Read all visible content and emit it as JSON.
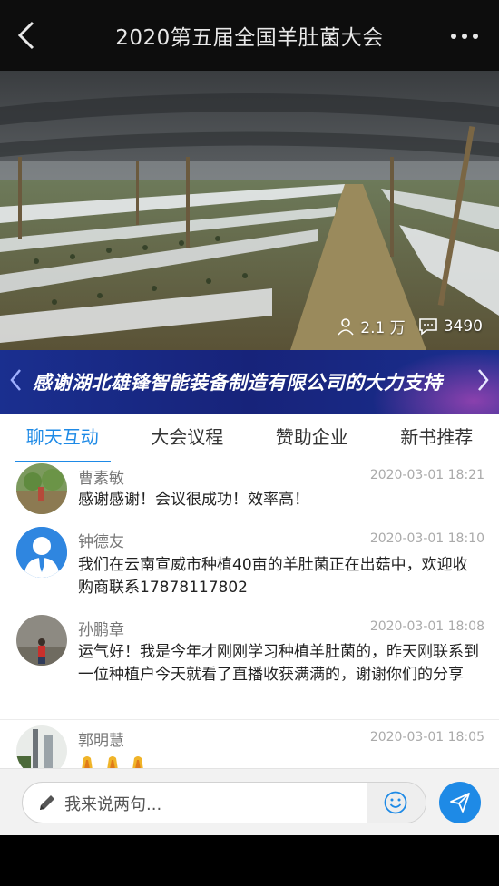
{
  "header": {
    "title": "2020第五届全国羊肚菌大会"
  },
  "video": {
    "viewers": "2.1 万",
    "comments": "3490"
  },
  "banner": {
    "text": "感谢湖北雄锋智能装备制造有限公司的大力支持"
  },
  "tabs": [
    {
      "label": "聊天互动",
      "active": true
    },
    {
      "label": "大会议程",
      "active": false
    },
    {
      "label": "赞助企业",
      "active": false
    },
    {
      "label": "新书推荐",
      "active": false
    }
  ],
  "messages": [
    {
      "name": "曹素敏",
      "time": "2020-03-01 18:21",
      "text": "感谢感谢！会议很成功！效率高！"
    },
    {
      "name": "钟德友",
      "time": "2020-03-01 18:10",
      "text": "我们在云南宣威市种植40亩的羊肚菌正在出菇中，欢迎收购商联系17878117802"
    },
    {
      "name": "孙鹏章",
      "time": "2020-03-01 18:08",
      "text": "运气好！我是今年才刚刚学习种植羊肚菌的，昨天刚联系到一位种植户今天就看了直播收获满满的，谢谢你们的分享"
    },
    {
      "name": "郭明慧",
      "time": "2020-03-01 18:05",
      "text": ""
    }
  ],
  "input": {
    "placeholder": "我来说两句..."
  },
  "colors": {
    "accent": "#1e8ae6",
    "banner": "#1a2f8f"
  }
}
